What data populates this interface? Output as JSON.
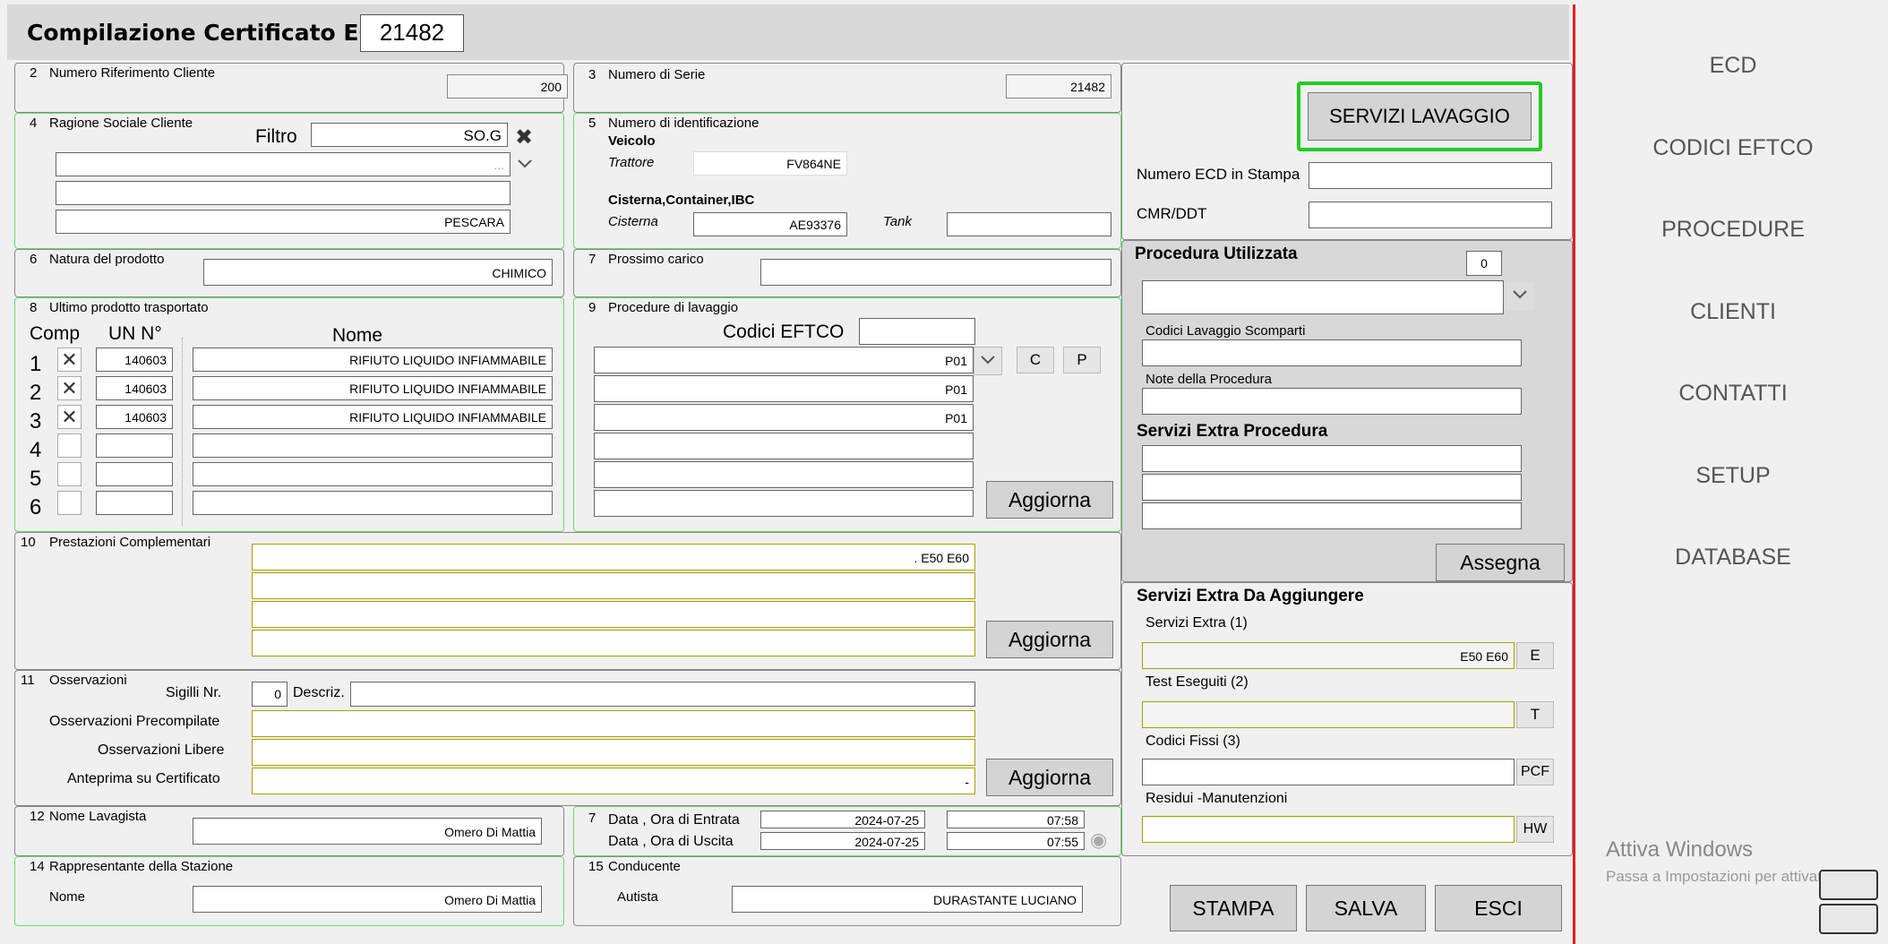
{
  "header": {
    "title": "Compilazione Certificato ECD",
    "cert_number": "21482"
  },
  "s2": {
    "label": "2",
    "title": "Numero Riferimento Cliente",
    "value": "200"
  },
  "s3": {
    "label": "3",
    "title": "Numero di Serie",
    "value": "21482"
  },
  "s4": {
    "label": "4",
    "title": "Ragione Sociale Cliente",
    "filter_label": "Filtro",
    "filter_value": "SO.G",
    "name_value": "...",
    "addr1": "",
    "addr2": "PESCARA"
  },
  "s5": {
    "label": "5",
    "title": "Numero di identificazione",
    "veicolo": "Veicolo",
    "trattore_label": "Trattore",
    "trattore_value": "FV864NE",
    "cisterna_head": "Cisterna,Container,IBC",
    "cisterna_label": "Cisterna",
    "cisterna_value": "AE93376",
    "tank_label": "Tank",
    "tank_value": ""
  },
  "s6": {
    "label": "6",
    "title": "Natura del prodotto",
    "value": "CHIMICO"
  },
  "s7a": {
    "label": "7",
    "title": "Prossimo carico",
    "value": ""
  },
  "s8": {
    "label": "8",
    "title": "Ultimo prodotto trasportato",
    "col_comp": "Comp",
    "col_un": "UN N°",
    "col_name": "Nome",
    "rows": [
      {
        "n": "1",
        "checked": "✕",
        "un": "140603",
        "name": "RIFIUTO LIQUIDO INFIAMMABILE"
      },
      {
        "n": "2",
        "checked": "✕",
        "un": "140603",
        "name": "RIFIUTO LIQUIDO INFIAMMABILE"
      },
      {
        "n": "3",
        "checked": "✕",
        "un": "140603",
        "name": "RIFIUTO LIQUIDO INFIAMMABILE"
      },
      {
        "n": "4",
        "checked": "",
        "un": "",
        "name": ""
      },
      {
        "n": "5",
        "checked": "",
        "un": "",
        "name": ""
      },
      {
        "n": "6",
        "checked": "",
        "un": "",
        "name": ""
      }
    ]
  },
  "s9": {
    "label": "9",
    "title": "Procedure di lavaggio",
    "codici_label": "Codici EFTCO",
    "codici_value": "",
    "codes": [
      "P01",
      "P01",
      "P01",
      "",
      "",
      ""
    ],
    "btn_c": "C",
    "btn_p": "P",
    "aggiorna": "Aggiorna"
  },
  "s10": {
    "label": "10",
    "title": "Prestazioni Complementari",
    "values": [
      ". E50 E60",
      "",
      "",
      ""
    ],
    "aggiorna": "Aggiorna"
  },
  "s11": {
    "label": "11",
    "title": "Osservazioni",
    "sigilli_label": "Sigilli  Nr.",
    "sigilli_value": "0",
    "descr_label": "Descriz.",
    "descr_value": "",
    "precomp_label": "Osservazioni Precompilate",
    "precomp_value": "",
    "libere_label": "Osservazioni Libere",
    "libere_value": "",
    "anteprima_label": "Anteprima su Certificato",
    "anteprima_value": "-",
    "aggiorna": "Aggiorna"
  },
  "s12": {
    "label": "12",
    "title": "Nome Lavagista",
    "value": "Omero Di Mattia"
  },
  "s7b": {
    "label": "7",
    "entrata_label": "Data , Ora di Entrata",
    "entrata_date": "2024-07-25",
    "entrata_time": "07:58",
    "uscita_label": "Data , Ora di Uscita",
    "uscita_date": "2024-07-25",
    "uscita_time": "07:55"
  },
  "s14": {
    "label": "14",
    "title": "Rappresentante della Stazione",
    "nome_label": "Nome",
    "value": "Omero Di Mattia"
  },
  "s15": {
    "label": "15",
    "title": "Conducente",
    "autista_label": "Autista",
    "value": "DURASTANTE LUCIANO"
  },
  "right": {
    "servizi_btn": "SERVIZI LAVAGGIO",
    "ecd_stampa_label": "Numero ECD in Stampa",
    "ecd_stampa_value": "",
    "cmr_label": "CMR/DDT",
    "cmr_value": ""
  },
  "proc": {
    "title": "Procedura Utilizzata",
    "count": "0",
    "select_value": "",
    "scomparti_label": "Codici Lavaggio Scomparti",
    "scomparti_value": "",
    "note_label": "Note della Procedura",
    "note_value": "",
    "extra_title": "Servizi Extra Procedura",
    "extra_values": [
      "",
      "",
      ""
    ],
    "assegna": "Assegna"
  },
  "extra": {
    "title": "Servizi Extra Da Aggiungere",
    "s1_label": "Servizi Extra (1)",
    "s1_value": "E50 E60",
    "s1_btn": "E",
    "s2_label": "Test Eseguiti (2)",
    "s2_value": "",
    "s2_btn": "T",
    "s3_label": "Codici Fissi (3)",
    "s3_value": "",
    "s3_btn": "PCF",
    "s4_label": "Residui -Manutenzioni",
    "s4_value": "",
    "s4_btn": "HW"
  },
  "actions": {
    "stampa": "STAMPA",
    "salva": "SALVA",
    "esci": "ESCI"
  },
  "sidebar": {
    "items": [
      "ECD",
      "CODICI EFTCO",
      "PROCEDURE",
      "CLIENTI",
      "CONTATTI",
      "SETUP",
      "DATABASE"
    ]
  },
  "watermark": {
    "line1": "Attiva Windows",
    "line2": "Passa a Impostazioni per attivare Wind"
  },
  "colors": {
    "green_border": "#66dd66",
    "accent_focus": "#22cc22",
    "divider": "#e02020"
  }
}
